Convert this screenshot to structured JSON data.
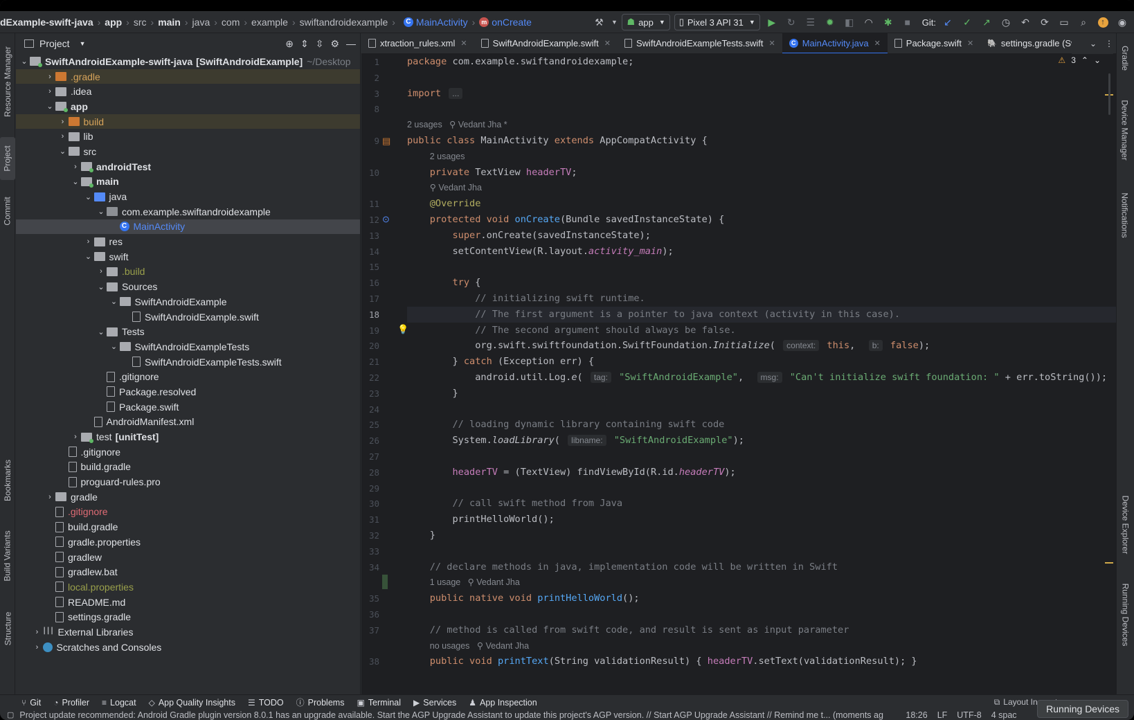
{
  "breadcrumbs": [
    {
      "label": "dExample-swift-java",
      "bold": true
    },
    {
      "label": "app",
      "bold": true
    },
    {
      "label": "src",
      "bold": false
    },
    {
      "label": "main",
      "bold": true
    },
    {
      "label": "java",
      "bold": false
    },
    {
      "label": "com",
      "bold": false
    },
    {
      "label": "example",
      "bold": false
    },
    {
      "label": "swiftandroidexample",
      "bold": false
    }
  ],
  "crumb_class": "MainActivity",
  "crumb_method": "onCreate",
  "toolbar": {
    "run_config": "app",
    "device": "Pixel 3 API 31",
    "git_label": "Git:"
  },
  "left_tools": {
    "resource_manager": "Resource Manager",
    "project": "Project",
    "commit": "Commit",
    "bookmarks": "Bookmarks",
    "build_variants": "Build Variants",
    "structure": "Structure"
  },
  "right_tools": {
    "gradle": "Gradle",
    "device_manager": "Device Manager",
    "notifications": "Notifications",
    "device_explorer": "Device Explorer",
    "running_devices": "Running Devices"
  },
  "project_panel": {
    "title": "Project",
    "root_name": "SwiftAndroidExample-swift-java",
    "root_module": "[SwiftAndroidExample]",
    "root_path": "~/Desktop",
    "items": [
      {
        "label": ".gradle",
        "depth": 1,
        "arrow": "right",
        "icon": "folder-orange",
        "color": "orange",
        "hl": true
      },
      {
        "label": ".idea",
        "depth": 1,
        "arrow": "right",
        "icon": "folder",
        "color": ""
      },
      {
        "label": "app",
        "depth": 1,
        "arrow": "down",
        "icon": "folder-module",
        "color": "",
        "bold": true
      },
      {
        "label": "build",
        "depth": 2,
        "arrow": "right",
        "icon": "folder-orange",
        "color": "orange",
        "hl": true
      },
      {
        "label": "lib",
        "depth": 2,
        "arrow": "right",
        "icon": "folder",
        "color": ""
      },
      {
        "label": "src",
        "depth": 2,
        "arrow": "down",
        "icon": "folder",
        "color": ""
      },
      {
        "label": "androidTest",
        "depth": 3,
        "arrow": "right",
        "icon": "folder-module",
        "color": "",
        "bold": true
      },
      {
        "label": "main",
        "depth": 3,
        "arrow": "down",
        "icon": "folder-module",
        "color": "",
        "bold": true
      },
      {
        "label": "java",
        "depth": 4,
        "arrow": "down",
        "icon": "folder-blue",
        "color": ""
      },
      {
        "label": "com.example.swiftandroidexample",
        "depth": 5,
        "arrow": "down",
        "icon": "package",
        "color": ""
      },
      {
        "label": "MainActivity",
        "depth": 6,
        "arrow": "none",
        "icon": "class",
        "color": "blue",
        "sel": true
      },
      {
        "label": "res",
        "depth": 4,
        "arrow": "right",
        "icon": "folder-res",
        "color": ""
      },
      {
        "label": "swift",
        "depth": 4,
        "arrow": "down",
        "icon": "folder",
        "color": ""
      },
      {
        "label": ".build",
        "depth": 5,
        "arrow": "right",
        "icon": "folder",
        "color": "green"
      },
      {
        "label": "Sources",
        "depth": 5,
        "arrow": "down",
        "icon": "folder",
        "color": ""
      },
      {
        "label": "SwiftAndroidExample",
        "depth": 6,
        "arrow": "down",
        "icon": "folder",
        "color": ""
      },
      {
        "label": "SwiftAndroidExample.swift",
        "depth": 7,
        "arrow": "none",
        "icon": "file",
        "color": ""
      },
      {
        "label": "Tests",
        "depth": 5,
        "arrow": "down",
        "icon": "folder",
        "color": ""
      },
      {
        "label": "SwiftAndroidExampleTests",
        "depth": 6,
        "arrow": "down",
        "icon": "folder",
        "color": ""
      },
      {
        "label": "SwiftAndroidExampleTests.swift",
        "depth": 7,
        "arrow": "none",
        "icon": "file",
        "color": ""
      },
      {
        "label": ".gitignore",
        "depth": 5,
        "arrow": "none",
        "icon": "file",
        "color": ""
      },
      {
        "label": "Package.resolved",
        "depth": 5,
        "arrow": "none",
        "icon": "file",
        "color": ""
      },
      {
        "label": "Package.swift",
        "depth": 5,
        "arrow": "none",
        "icon": "file",
        "color": ""
      },
      {
        "label": "AndroidManifest.xml",
        "depth": 4,
        "arrow": "none",
        "icon": "file",
        "color": ""
      },
      {
        "label": "test",
        "suffix": "[unitTest]",
        "depth": 3,
        "arrow": "right",
        "icon": "folder-module",
        "color": ""
      },
      {
        "label": ".gitignore",
        "depth": 2,
        "arrow": "none",
        "icon": "file",
        "color": ""
      },
      {
        "label": "build.gradle",
        "depth": 2,
        "arrow": "none",
        "icon": "file",
        "color": ""
      },
      {
        "label": "proguard-rules.pro",
        "depth": 2,
        "arrow": "none",
        "icon": "file",
        "color": ""
      },
      {
        "label": "gradle",
        "depth": 1,
        "arrow": "right",
        "icon": "folder",
        "color": ""
      },
      {
        "label": ".gitignore",
        "depth": 1,
        "arrow": "none",
        "icon": "file",
        "color": "red"
      },
      {
        "label": "build.gradle",
        "depth": 1,
        "arrow": "none",
        "icon": "file",
        "color": ""
      },
      {
        "label": "gradle.properties",
        "depth": 1,
        "arrow": "none",
        "icon": "file",
        "color": ""
      },
      {
        "label": "gradlew",
        "depth": 1,
        "arrow": "none",
        "icon": "file",
        "color": ""
      },
      {
        "label": "gradlew.bat",
        "depth": 1,
        "arrow": "none",
        "icon": "file",
        "color": ""
      },
      {
        "label": "local.properties",
        "depth": 1,
        "arrow": "none",
        "icon": "file",
        "color": "green"
      },
      {
        "label": "README.md",
        "depth": 1,
        "arrow": "none",
        "icon": "file",
        "color": ""
      },
      {
        "label": "settings.gradle",
        "depth": 1,
        "arrow": "none",
        "icon": "file",
        "color": ""
      },
      {
        "label": "External Libraries",
        "depth": 0,
        "arrow": "right",
        "icon": "libs",
        "color": ""
      },
      {
        "label": "Scratches and Consoles",
        "depth": 0,
        "arrow": "right",
        "icon": "scratch",
        "color": ""
      }
    ]
  },
  "editor_tabs": [
    {
      "label": "xtraction_rules.xml",
      "icon": "file"
    },
    {
      "label": "SwiftAndroidExample.swift",
      "icon": "file"
    },
    {
      "label": "SwiftAndroidExampleTests.swift",
      "icon": "file"
    },
    {
      "label": "MainActivity.java",
      "icon": "class",
      "active": true
    },
    {
      "label": "Package.swift",
      "icon": "file"
    },
    {
      "label": "settings.gradle (SwiftAnd",
      "icon": "gradle"
    }
  ],
  "warnings_count": "3",
  "code_lines": [
    {
      "n": "1",
      "html": "<span class=\"kw\">package</span> com.example.swiftandroidexample;"
    },
    {
      "n": "2",
      "html": ""
    },
    {
      "n": "3",
      "html": "<span class=\"kw\">import</span> <span class=\"inlay\">...</span>"
    },
    {
      "n": "8",
      "html": ""
    },
    {
      "n": "",
      "html": "<span class=\"hint\">2 usages   ⚲ Vedant Jha *</span>"
    },
    {
      "n": "9",
      "html": "<span class=\"kw\">public class</span> MainActivity <span class=\"kw\">extends</span> AppCompatActivity {"
    },
    {
      "n": "",
      "html": "    <span class=\"hint\">2 usages</span>"
    },
    {
      "n": "10",
      "html": "    <span class=\"kw\">private</span> TextView <span class=\"fld\">headerTV</span>;"
    },
    {
      "n": "",
      "html": "    <span class=\"hint\">⚲ Vedant Jha</span>"
    },
    {
      "n": "11",
      "html": "    <span class=\"ann\">@Override</span>"
    },
    {
      "n": "12",
      "html": "    <span class=\"kw\">protected void</span> <span class=\"fn\">onCreate</span>(Bundle savedInstanceState) {"
    },
    {
      "n": "13",
      "html": "        <span class=\"kw\">super</span>.onCreate(savedInstanceState);"
    },
    {
      "n": "14",
      "html": "        setContentView(R.layout.<span class=\"fld itl\">activity_main</span>);"
    },
    {
      "n": "15",
      "html": ""
    },
    {
      "n": "16",
      "html": "        <span class=\"kw\">try</span> {"
    },
    {
      "n": "17",
      "html": "            <span class=\"cmt\">// initializing swift runtime.</span>"
    },
    {
      "n": "18",
      "html": "            <span class=\"cmt\">// The first argument is a pointer to java context (activity in this case).</span>",
      "cur": true
    },
    {
      "n": "19",
      "html": "            <span class=\"cmt\">// The second argument should always be false.</span>"
    },
    {
      "n": "20",
      "html": "            org.swift.swiftfoundation.SwiftFoundation.<span class=\"itl\">Initialize</span>( <span class=\"inlay\">context:</span> <span class=\"kw\">this</span>,  <span class=\"inlay\">b:</span> <span class=\"kw\">false</span>);"
    },
    {
      "n": "21",
      "html": "        } <span class=\"kw\">catch</span> (Exception err) {"
    },
    {
      "n": "22",
      "html": "            android.util.Log.<span class=\"itl\">e</span>( <span class=\"inlay\">tag:</span> <span class=\"str\">\"SwiftAndroidExample\"</span>,  <span class=\"inlay\">msg:</span> <span class=\"str\">\"Can't initialize swift foundation: \"</span> + err.toString());"
    },
    {
      "n": "23",
      "html": "        }"
    },
    {
      "n": "24",
      "html": ""
    },
    {
      "n": "25",
      "html": "        <span class=\"cmt\">// loading dynamic library containing swift code</span>"
    },
    {
      "n": "26",
      "html": "        System.<span class=\"itl\">loadLibrary</span>( <span class=\"inlay\">libname:</span> <span class=\"str\">\"SwiftAndroidExample\"</span>);"
    },
    {
      "n": "27",
      "html": ""
    },
    {
      "n": "28",
      "html": "        <span class=\"fld\">headerTV</span> = (TextView) findViewById(R.id.<span class=\"fld itl\">headerTV</span>);"
    },
    {
      "n": "29",
      "html": ""
    },
    {
      "n": "30",
      "html": "        <span class=\"cmt\">// call swift method from Java</span>"
    },
    {
      "n": "31",
      "html": "        printHelloWorld();"
    },
    {
      "n": "32",
      "html": "    }"
    },
    {
      "n": "33",
      "html": ""
    },
    {
      "n": "34",
      "html": "    <span class=\"cmt\">// declare methods in java, implementation code will be written in Swift</span>"
    },
    {
      "n": "",
      "html": "    <span class=\"hint\">1 usage   ⚲ Vedant Jha</span>"
    },
    {
      "n": "35",
      "html": "    <span class=\"kw\">public native void</span> <span class=\"fn\">printHelloWorld</span>();"
    },
    {
      "n": "36",
      "html": ""
    },
    {
      "n": "37",
      "html": "    <span class=\"cmt\">// method is called from swift code, and result is sent as input parameter</span>"
    },
    {
      "n": "",
      "html": "    <span class=\"hint\">no usages   ⚲ Vedant Jha</span>"
    },
    {
      "n": "38",
      "html": "    <span class=\"kw\">public void</span> <span class=\"fn\">printText</span>(String validationResult) { <span class=\"fld\">headerTV</span>.setText(validationResult); }"
    }
  ],
  "bottom_tabs": [
    {
      "label": "Git",
      "icon": "⑂"
    },
    {
      "label": "Profiler",
      "icon": "◔"
    },
    {
      "label": "Logcat",
      "icon": "≡"
    },
    {
      "label": "App Quality Insights",
      "icon": "◇"
    },
    {
      "label": "TODO",
      "icon": "☰"
    },
    {
      "label": "Problems",
      "icon": "ⓘ"
    },
    {
      "label": "Terminal",
      "icon": "▣"
    },
    {
      "label": "Services",
      "icon": "▶"
    },
    {
      "label": "App Inspection",
      "icon": "♟"
    }
  ],
  "layout_inspector": "Layout Inspector",
  "status": {
    "message": "Project update recommended: Android Gradle plugin version 8.0.1 has an upgrade available.  Start the AGP Upgrade Assistant to update this project's AGP version. // Start AGP Upgrade Assistant // Remind me t... (moments ag",
    "position": "18:26",
    "line_sep": "LF",
    "encoding": "UTF-8",
    "indent": "4 spac"
  },
  "running_devices_badge": "Running Devices",
  "colors": {
    "accent": "#3574f0",
    "keyword": "#cf8e6d",
    "string": "#6aab73",
    "comment": "#7a7e85"
  }
}
